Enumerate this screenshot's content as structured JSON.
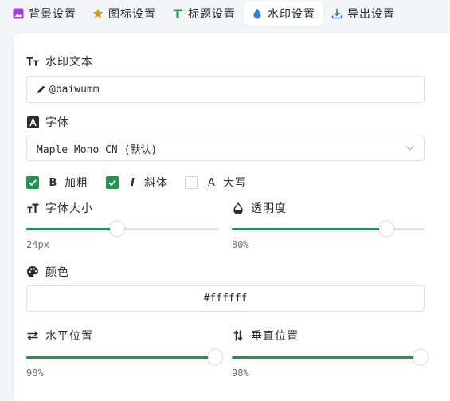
{
  "tabs": [
    {
      "label": "背景设置",
      "icon": "image-icon",
      "active": false
    },
    {
      "label": "图标设置",
      "icon": "star-icon",
      "active": false
    },
    {
      "label": "标题设置",
      "icon": "text-t-icon",
      "active": false
    },
    {
      "label": "水印设置",
      "icon": "droplet-icon",
      "active": true
    },
    {
      "label": "导出设置",
      "icon": "download-icon",
      "active": false
    }
  ],
  "watermark_text": {
    "label": "水印文本",
    "value": "@baiwumm"
  },
  "font": {
    "label": "字体",
    "selected": "Maple Mono CN (默认)"
  },
  "styles": {
    "bold_label": "加粗",
    "bold_checked": true,
    "italic_label": "斜体",
    "italic_checked": true,
    "upper_label": "大写",
    "upper_checked": false
  },
  "font_size": {
    "label": "字体大小",
    "value_text": "24px",
    "fraction": 0.47
  },
  "opacity": {
    "label": "透明度",
    "value_text": "80%",
    "fraction": 0.8
  },
  "color": {
    "label": "颜色",
    "value": "#ffffff"
  },
  "h_pos": {
    "label": "水平位置",
    "value_text": "98%",
    "fraction": 0.98
  },
  "v_pos": {
    "label": "垂直位置",
    "value_text": "98%",
    "fraction": 0.98
  },
  "colors": {
    "accent": "#22964f",
    "tab_image": "#a23fd8",
    "tab_star": "#d69a1b",
    "tab_text": "#22964f",
    "tab_drop": "#2f7de1",
    "tab_download": "#2f6fd1"
  }
}
